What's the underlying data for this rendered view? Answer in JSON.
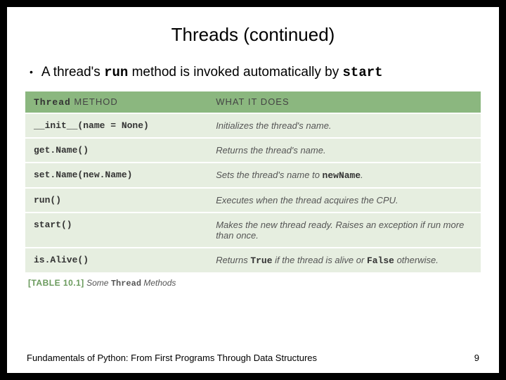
{
  "title": "Threads (continued)",
  "bullet": {
    "prefix": "A thread's ",
    "code1": "run",
    "mid": " method is invoked automatically by ",
    "code2": "start"
  },
  "table": {
    "header": {
      "col1_code": "Thread",
      "col1_rest": " METHOD",
      "col2": "WHAT IT DOES"
    },
    "rows": [
      {
        "method": "__init__(name = None)",
        "desc_pre": "Initializes the thread's name.",
        "desc_code": "",
        "desc_post": ""
      },
      {
        "method": "get.Name()",
        "desc_pre": "Returns the thread's name.",
        "desc_code": "",
        "desc_post": ""
      },
      {
        "method": "set.Name(new.Name)",
        "desc_pre": "Sets the thread's name to ",
        "desc_code": "newName",
        "desc_post": "."
      },
      {
        "method": "run()",
        "desc_pre": "Executes when the thread acquires the CPU.",
        "desc_code": "",
        "desc_post": ""
      },
      {
        "method": "start()",
        "desc_pre": "Makes the new thread ready. Raises an exception if run more than once.",
        "desc_code": "",
        "desc_post": ""
      },
      {
        "method": "is.Alive()",
        "desc_pre": "Returns ",
        "desc_code": "True",
        "desc_post": " if the thread is alive or ",
        "desc_code2": "False",
        "desc_post2": " otherwise."
      }
    ]
  },
  "caption": {
    "tag": "[TABLE 10.1]",
    "pre": " Some ",
    "code": "Thread",
    "post": " Methods"
  },
  "footer": {
    "left": "Fundamentals of Python: From First Programs Through Data Structures",
    "right": "9"
  },
  "chart_data": {
    "type": "table",
    "title": "Some Thread Methods",
    "columns": [
      "Thread METHOD",
      "WHAT IT DOES"
    ],
    "rows": [
      [
        "__init__(name = None)",
        "Initializes the thread's name."
      ],
      [
        "get.Name()",
        "Returns the thread's name."
      ],
      [
        "set.Name(new.Name)",
        "Sets the thread's name to newName."
      ],
      [
        "run()",
        "Executes when the thread acquires the CPU."
      ],
      [
        "start()",
        "Makes the new thread ready. Raises an exception if run more than once."
      ],
      [
        "is.Alive()",
        "Returns True if the thread is alive or False otherwise."
      ]
    ]
  }
}
